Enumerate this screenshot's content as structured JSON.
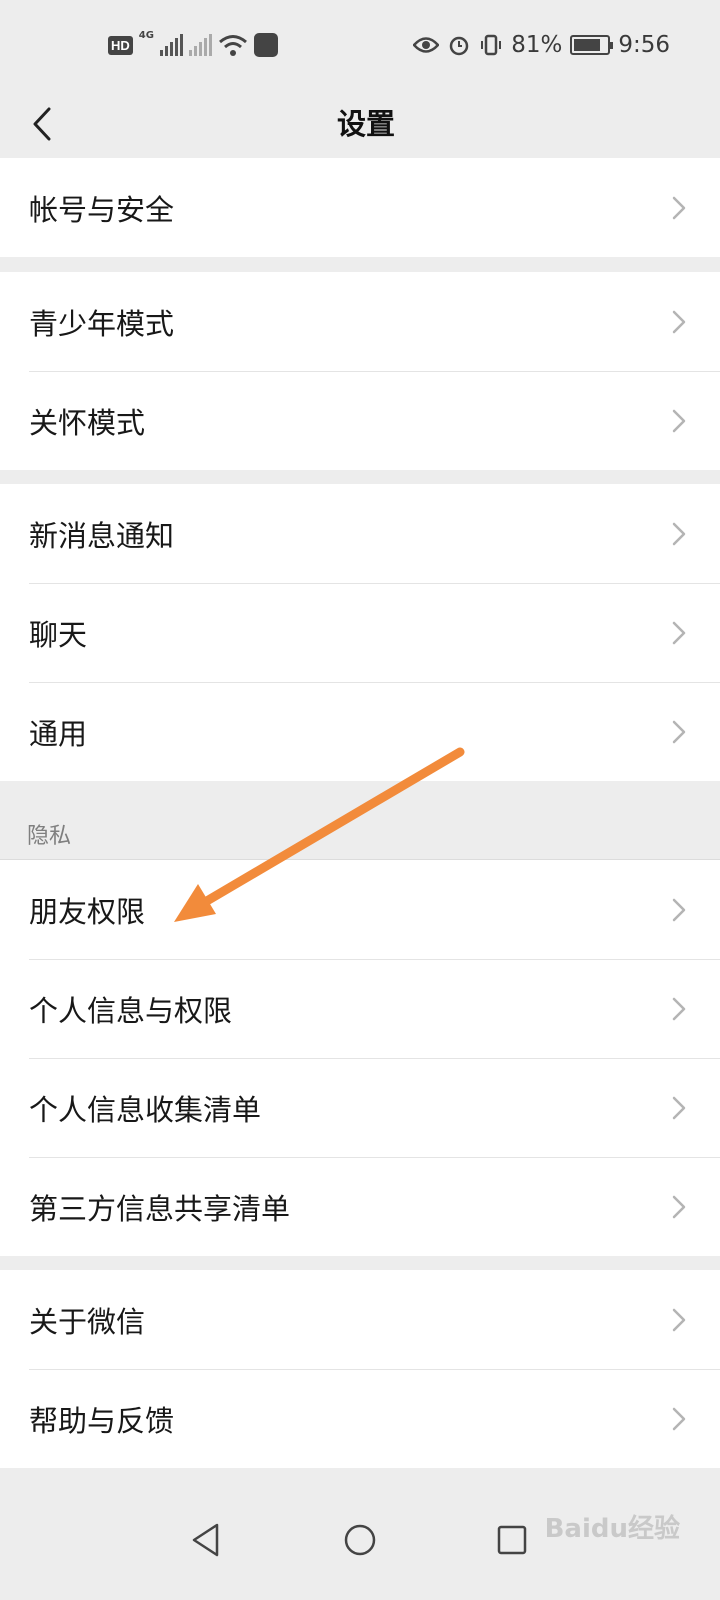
{
  "status_bar": {
    "hd": "HD",
    "net": "4G",
    "battery_percent_text": "81%",
    "battery_level": 0.81,
    "time": "9:56"
  },
  "header": {
    "title": "设置"
  },
  "groups": {
    "account": [
      "帐号与安全"
    ],
    "modes": [
      "青少年模式",
      "关怀模式"
    ],
    "general": [
      "新消息通知",
      "聊天",
      "通用"
    ],
    "privacy_section_title": "隐私",
    "privacy": [
      "朋友权限",
      "个人信息与权限",
      "个人信息收集清单",
      "第三方信息共享清单"
    ],
    "about": [
      "关于微信",
      "帮助与反馈"
    ]
  },
  "annotation": {
    "arrow_color": "#f28b3b"
  },
  "watermark": "Baidu经验",
  "icons": {
    "back": "chevron-left-icon",
    "row_chevron": "chevron-right-icon",
    "nav_back": "triangle-back-icon",
    "nav_home": "circle-home-icon",
    "nav_recent": "square-recent-icon"
  }
}
